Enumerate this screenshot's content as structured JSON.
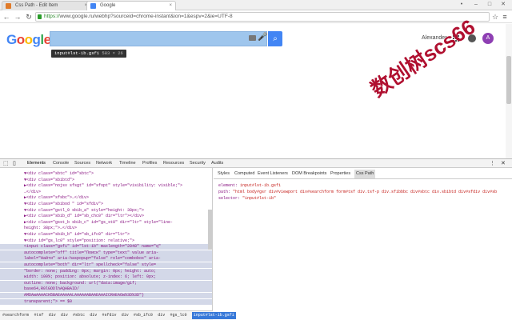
{
  "tabs": [
    {
      "title": "Css Path - Edit Item"
    },
    {
      "title": "Google"
    }
  ],
  "window_controls": {
    "user": "•",
    "minimize": "–",
    "maximize": "□",
    "close": "✕"
  },
  "toolbar": {
    "back": "←",
    "forward": "→",
    "reload": "↻",
    "url_scheme": "https://",
    "url_rest": "www.google.ru/webhp?sourceid=chrome-instant&ion=1&espv=2&ie=UTF-8",
    "star": "☆",
    "menu": "≡"
  },
  "google": {
    "logo": "Google",
    "search_value": "",
    "mic": "🎤",
    "search_btn": "⌕",
    "user_name": "Alexander",
    "avatar_letter": "A"
  },
  "tooltip": {
    "selector": "input#lst-ib.gsfi",
    "size": "583 × 26"
  },
  "watermark": "数创树scs66",
  "devtools": {
    "tabs": [
      "Elements",
      "Console",
      "Sources",
      "Network",
      "Timeline",
      "Profiles",
      "Resources",
      "Security",
      "Audits"
    ],
    "dom_lines": [
      "▼<div class=\"sbtc\" id=\"sbtc\">",
      "  ▼<div class=\"sbibtd\">",
      "    ▶<div class=\"nojsv sfsgt\" id=\"sfopt\" style=\"visibility: visible;\">",
      "      …</div>",
      "    ▶<div class=\"sfsbc\">…</div>",
      "    ▼<div class=\"sbibod \" id=\"sfdiv\">",
      "      ▼<div class=\"gstl_0 sbib_a\" style=\"height: 38px;\">",
      "        ▶<div class=\"sbib_d\" id=\"sb_chc0\" dir=\"ltr\"></div>",
      "        ▶<div class=\"gsst_b sbib_c\" id=\"gs_st0\" dir=\"ltr\" style=\"line-",
      "          height: 38px;\">…</div>",
      "        ▼<div class=\"sbib_b\" id=\"sb_ifc0\" dir=\"ltr\">",
      "          ▼<div id=\"gs_lc0\" style=\"position: relative;\">",
      "            <input class=\"gsfi\" id=\"lst-ib\" maxlength=\"2048\" name=\"q\"",
      "            autocomplete=\"off\" title=\"Поиск\" type=\"text\" value aria-",
      "            label=\"Найти\" aria-haspopup=\"false\" role=\"combobox\" aria-",
      "            autocomplete=\"both\" dir=\"ltr\" spellcheck=\"false\" style=",
      "            \"border: none; padding: 0px; margin: 0px; height: auto;",
      "            width: 100%; position: absolute; z-index: 6; left: 0px;",
      "            outline: none; background: url(\"data:image/gif;",
      "            base64,R0lGODlhAQABAID/",
      "            AMDAwAAAACH5BAEAAAAALAAAAAABAAEAAAICRAEAOw%3D%3D\")",
      "            transparent;\"> == $0"
    ],
    "side_tabs": [
      "Styles",
      "Computed",
      "Event Listeners",
      "DOM Breakpoints",
      "Properties",
      "Css Path"
    ],
    "side_lines": [
      {
        "key": "element: ",
        "val": "input#lst-ib.gsfi"
      },
      {
        "key": "path: ",
        "val": "\"html body#gsr div#viewport div#searchform form#tsf div.tsf-p div.sfibbbc div#sbtc div.sbibtd div#sfdiv div#sb"
      },
      {
        "key": "selector: ",
        "val": "\"input#lst-ib\""
      }
    ],
    "breadcrumbs": [
      "#searchform",
      "#tsf",
      "div",
      "div",
      "#sbtc",
      "div",
      "#sfdiv",
      "div",
      "#sb_ifc0",
      "div",
      "#gs_lc0",
      "input#lst-ib.gsfi"
    ]
  },
  "colors": {
    "search_highlight": "#9fc6ed",
    "google_blue": "#4285f4",
    "avatar": "#8e3fb3",
    "watermark": "#b01030"
  }
}
